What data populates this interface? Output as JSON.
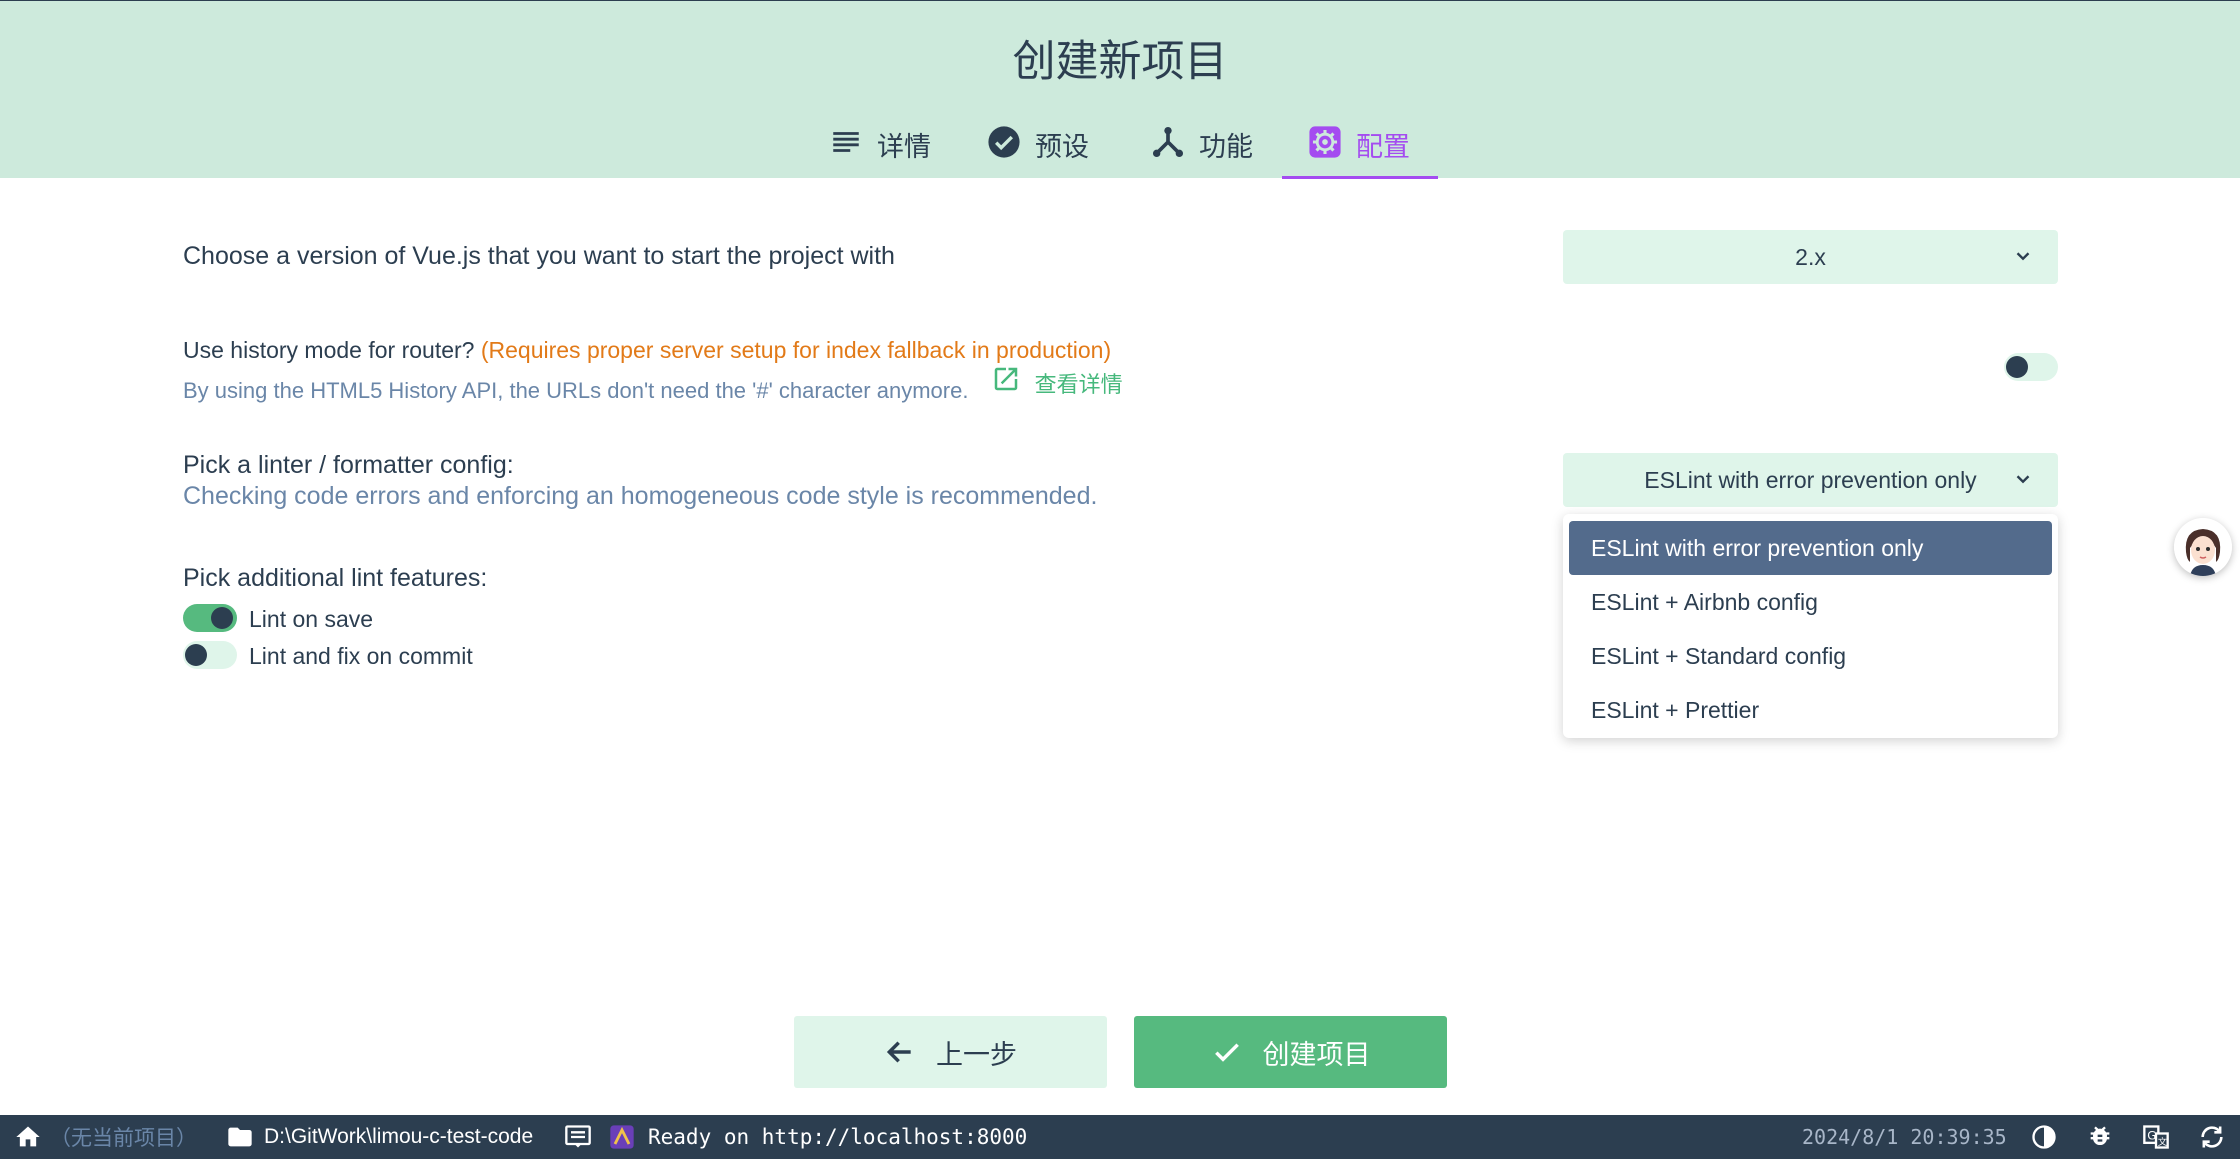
{
  "page_title": "创建新项目",
  "tabs": [
    {
      "label": "详情",
      "icon": "list-icon"
    },
    {
      "label": "预设",
      "icon": "check-circle-icon"
    },
    {
      "label": "功能",
      "icon": "fork-icon"
    },
    {
      "label": "配置",
      "icon": "gear-icon",
      "active": true
    }
  ],
  "settings": {
    "vue_version": {
      "label": "Choose a version of Vue.js that you want to start the project with",
      "value": "2.x"
    },
    "history_mode": {
      "label": "Use history mode for router?",
      "warning": "(Requires proper server setup for index fallback in production)",
      "description": "By using the HTML5 History API, the URLs don't need the '#' character anymore.",
      "link": "查看详情",
      "enabled": false
    },
    "linter": {
      "label": "Pick a linter / formatter config:",
      "description": "Checking code errors and enforcing an homogeneous code style is recommended.",
      "value": "ESLint with error prevention only",
      "options": [
        "ESLint with error prevention only",
        "ESLint + Airbnb config",
        "ESLint + Standard config",
        "ESLint + Prettier"
      ]
    },
    "lint_features": {
      "label": "Pick additional lint features:",
      "items": [
        {
          "label": "Lint on save",
          "enabled": true
        },
        {
          "label": "Lint and fix on commit",
          "enabled": false
        }
      ]
    }
  },
  "buttons": {
    "prev": "上一步",
    "create": "创建项目"
  },
  "statusbar": {
    "no_project": "（无当前项目）",
    "path": "D:\\GitWork\\limou-c-test-code",
    "log": "Ready on http://localhost:8000",
    "timestamp": "2024/8/1 20:39:35"
  },
  "colors": {
    "header_bg": "#cdeadc",
    "accent": "#a44cf0",
    "primary": "#56ba7f",
    "dark": "#2c3e50",
    "warning": "#e27a18",
    "muted": "#6a86a8"
  }
}
